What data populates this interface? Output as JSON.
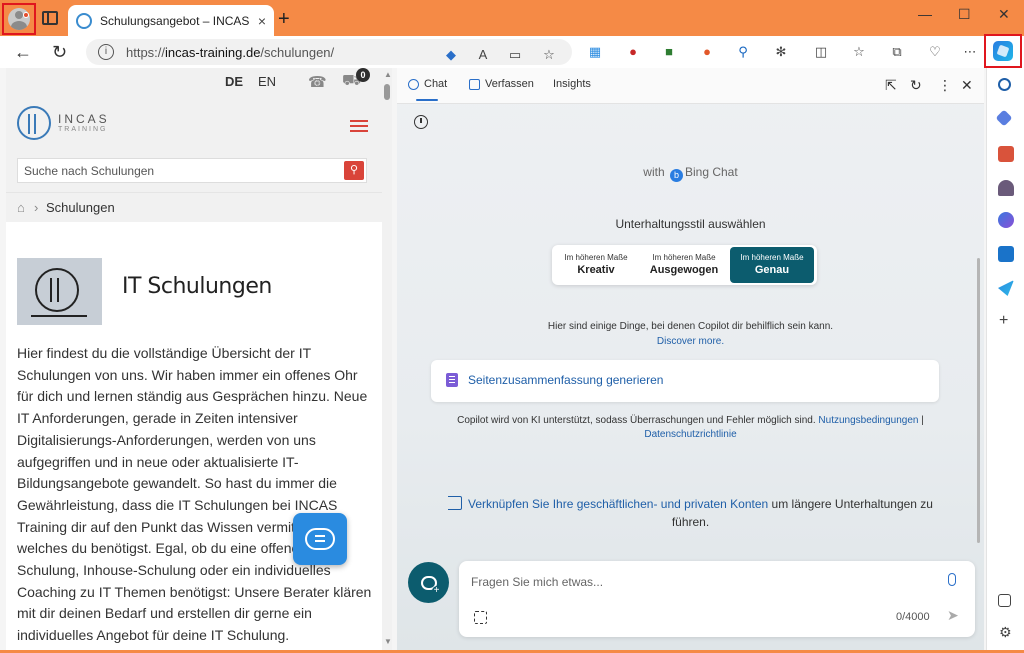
{
  "browser": {
    "tab_title": "Schulungsangebot – INCAS Training",
    "tab_close": "×",
    "new_tab": "+",
    "url_prefix": "https://",
    "url_host": "incas-training.de",
    "url_path": "/schulungen/",
    "window_controls": [
      "—",
      "☐",
      "✕"
    ]
  },
  "site": {
    "lang_de": "DE",
    "lang_en": "EN",
    "cart_count": "0",
    "logo_name": "INCAS",
    "logo_sub": "TRAINING",
    "search_placeholder": "Suche nach Schulungen",
    "breadcrumb_sep": "›",
    "breadcrumb": "Schulungen",
    "hero_title": "IT Schulungen",
    "body_text": "Hier findest du die vollständige Übersicht der IT Schulungen von uns. Wir haben immer ein offenes Ohr für dich und lernen ständig aus Gesprächen hinzu. Neue IT Anforderungen, gerade in Zeiten intensiver Digitalisierungs-Anforderungen, werden von uns aufgegriffen und in neue oder aktualisierte IT-Bildungsangebote gewandelt. So hast du immer die Gewährleistung, dass die IT Schulungen bei INCAS Training dir auf den Punkt das Wissen vermitteln, welches du benötigst. Egal, ob du eine offene IT Schulung, Inhouse-Schulung oder ein individuelles Coaching zu IT Themen benötigst: Unsere Berater klären mit dir deinen Bedarf und erstellen dir gerne ein individuelles Angebot für deine IT Schulung."
  },
  "copilot": {
    "tabs": [
      "Chat",
      "Verfassen",
      "Insights"
    ],
    "with_label": "with",
    "bing_label": "Bing Chat",
    "style_label": "Unterhaltungsstil auswählen",
    "style_options": [
      {
        "small": "Im höheren Maße",
        "main": "Kreativ"
      },
      {
        "small": "Im höheren Maße",
        "main": "Ausgewogen"
      },
      {
        "small": "Im höheren Maße",
        "main": "Genau"
      }
    ],
    "help_text": "Hier sind einige Dinge, bei denen Copilot dir behilflich sein kann.",
    "discover_more": "Discover more.",
    "summary_action": "Seitenzusammenfassung generieren",
    "disclaimer_text": "Copilot wird von KI unterstützt, sodass Überraschungen und Fehler möglich sind.",
    "disclaimer_terms": "Nutzungsbedingungen",
    "disclaimer_sep": "|",
    "disclaimer_privacy": "Datenschutzrichtlinie",
    "connect_link": "Verknüpfen Sie Ihre geschäftlichen- und privaten Konten",
    "connect_rest": "um längere Unterhaltungen zu führen.",
    "input_placeholder": "Fragen Sie mich etwas...",
    "char_count": "0/4000"
  },
  "sidebar_icons": [
    "search-icon",
    "tag-icon",
    "toolbox-icon",
    "chess-icon",
    "m365-icon",
    "outlook-icon",
    "send-icon"
  ],
  "colors": {
    "titlebar": "#f58a46",
    "accent": "#0c5c6e",
    "link": "#1f5fa8",
    "site_red": "#d9443a"
  }
}
